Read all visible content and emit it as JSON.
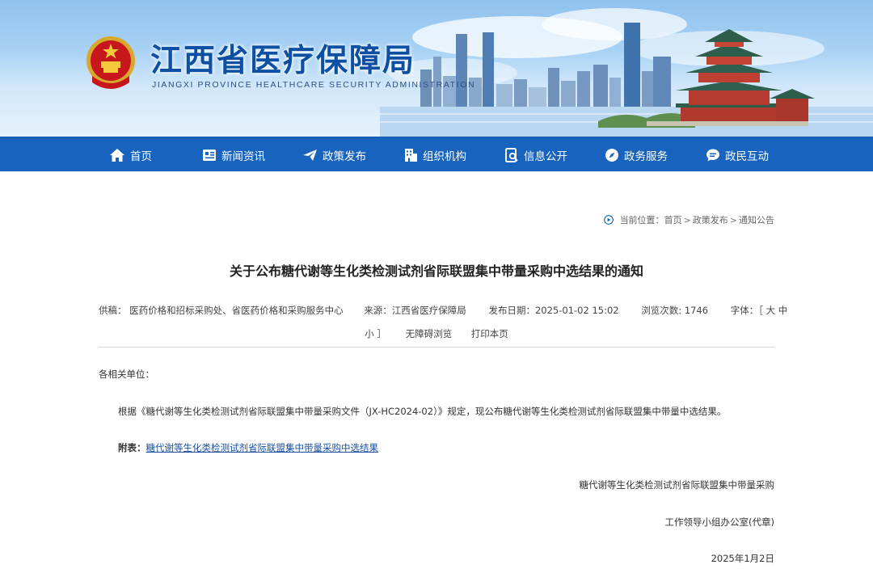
{
  "site": {
    "title": "江西省医疗保障局",
    "subtitle": "JIANGXI PROVINCE HEALTHCARE SECURITY ADMINISTRATION"
  },
  "nav": {
    "items": [
      {
        "label": "首页",
        "icon": "home-icon"
      },
      {
        "label": "新闻资讯",
        "icon": "news-icon"
      },
      {
        "label": "政策发布",
        "icon": "paper-plane-icon"
      },
      {
        "label": "组织机构",
        "icon": "building-icon"
      },
      {
        "label": "信息公开",
        "icon": "info-doc-icon"
      },
      {
        "label": "政务服务",
        "icon": "compass-icon"
      },
      {
        "label": "政民互动",
        "icon": "chat-icon"
      }
    ]
  },
  "breadcrumb": {
    "prefix": "当前位置：",
    "items": [
      "首页",
      "政策发布",
      "通知公告"
    ],
    "separator": ">"
  },
  "article": {
    "title": "关于公布糖代谢等生化类检测试剂省际联盟集中带量采购中选结果的通知",
    "meta": {
      "supplier": "供稿：  医药价格和招标采购处、省医药价格和采购服务中心",
      "source": "来源：江西省医疗保障局",
      "publish_date": "发布日期：2025-01-02 15:02",
      "views": "浏览次数: 1746",
      "font_label": "字体：［ 大  中",
      "font_label_cont": "小 ］",
      "accessible": "无障碍浏览",
      "print": "打印本页"
    },
    "salutation": "各相关单位：",
    "body": "根据《糖代谢等生化类检测试剂省际联盟集中带量采购文件（JX-HC2024-02）》规定，现公布糖代谢等生化类检测试剂省际联盟集中带量中选结果。",
    "attachment_label": "附表：",
    "attachment_link": "糖代谢等生化类检测试剂省际联盟集中带量采购中选结果",
    "signature_line1": "糖代谢等生化类检测试剂省际联盟集中带量采购",
    "signature_line2": "工作领导小组办公室(代章)",
    "date": "2025年1月2日"
  },
  "colors": {
    "nav_bg": "#1763bd",
    "title_blue": "#0d4fa3",
    "link": "#1b4f9c"
  }
}
